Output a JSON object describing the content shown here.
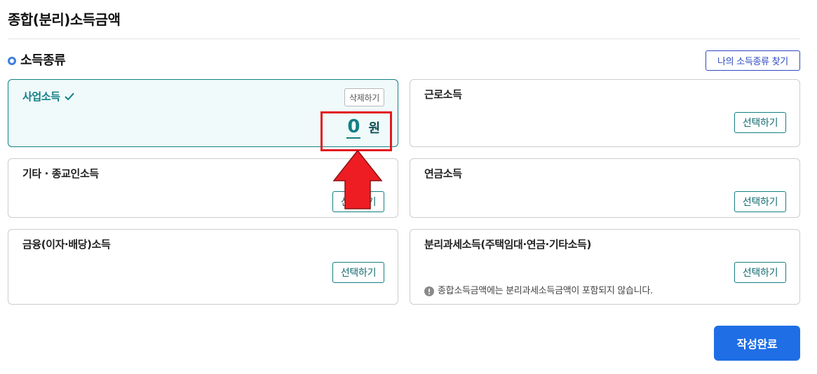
{
  "page": {
    "title": "종합(분리)소득금액"
  },
  "section": {
    "heading": "소득종류",
    "find_button": "나의 소득종류 찾기"
  },
  "cards": [
    {
      "label": "사업소득",
      "selected": true,
      "delete_label": "삭제하기",
      "amount": "0",
      "unit": "원"
    },
    {
      "label": "근로소득",
      "action_label": "선택하기"
    },
    {
      "label": "기타 · 종교인소득",
      "action_label": "선택하기"
    },
    {
      "label": "연금소득",
      "action_label": "선택하기"
    },
    {
      "label": "금융(이자·배당)소득",
      "action_label": "선택하기"
    },
    {
      "label": "분리과세소득(주택임대·연금·기타소득)",
      "action_label": "선택하기",
      "note": "종합소득금액에는 분리과세소득금액이 포함되지 않습니다."
    }
  ],
  "footer": {
    "submit_label": "작성완료"
  },
  "icons": {
    "section_marker": "ring-icon",
    "selected_check": "check-icon",
    "note": "info-icon",
    "annotation": "up-arrow-icon"
  },
  "colors": {
    "accent": "#137f86",
    "primary": "#1f6ee6",
    "link": "#2d49c0",
    "marker": "#3f7fe0",
    "annotation": "#e3191f"
  }
}
